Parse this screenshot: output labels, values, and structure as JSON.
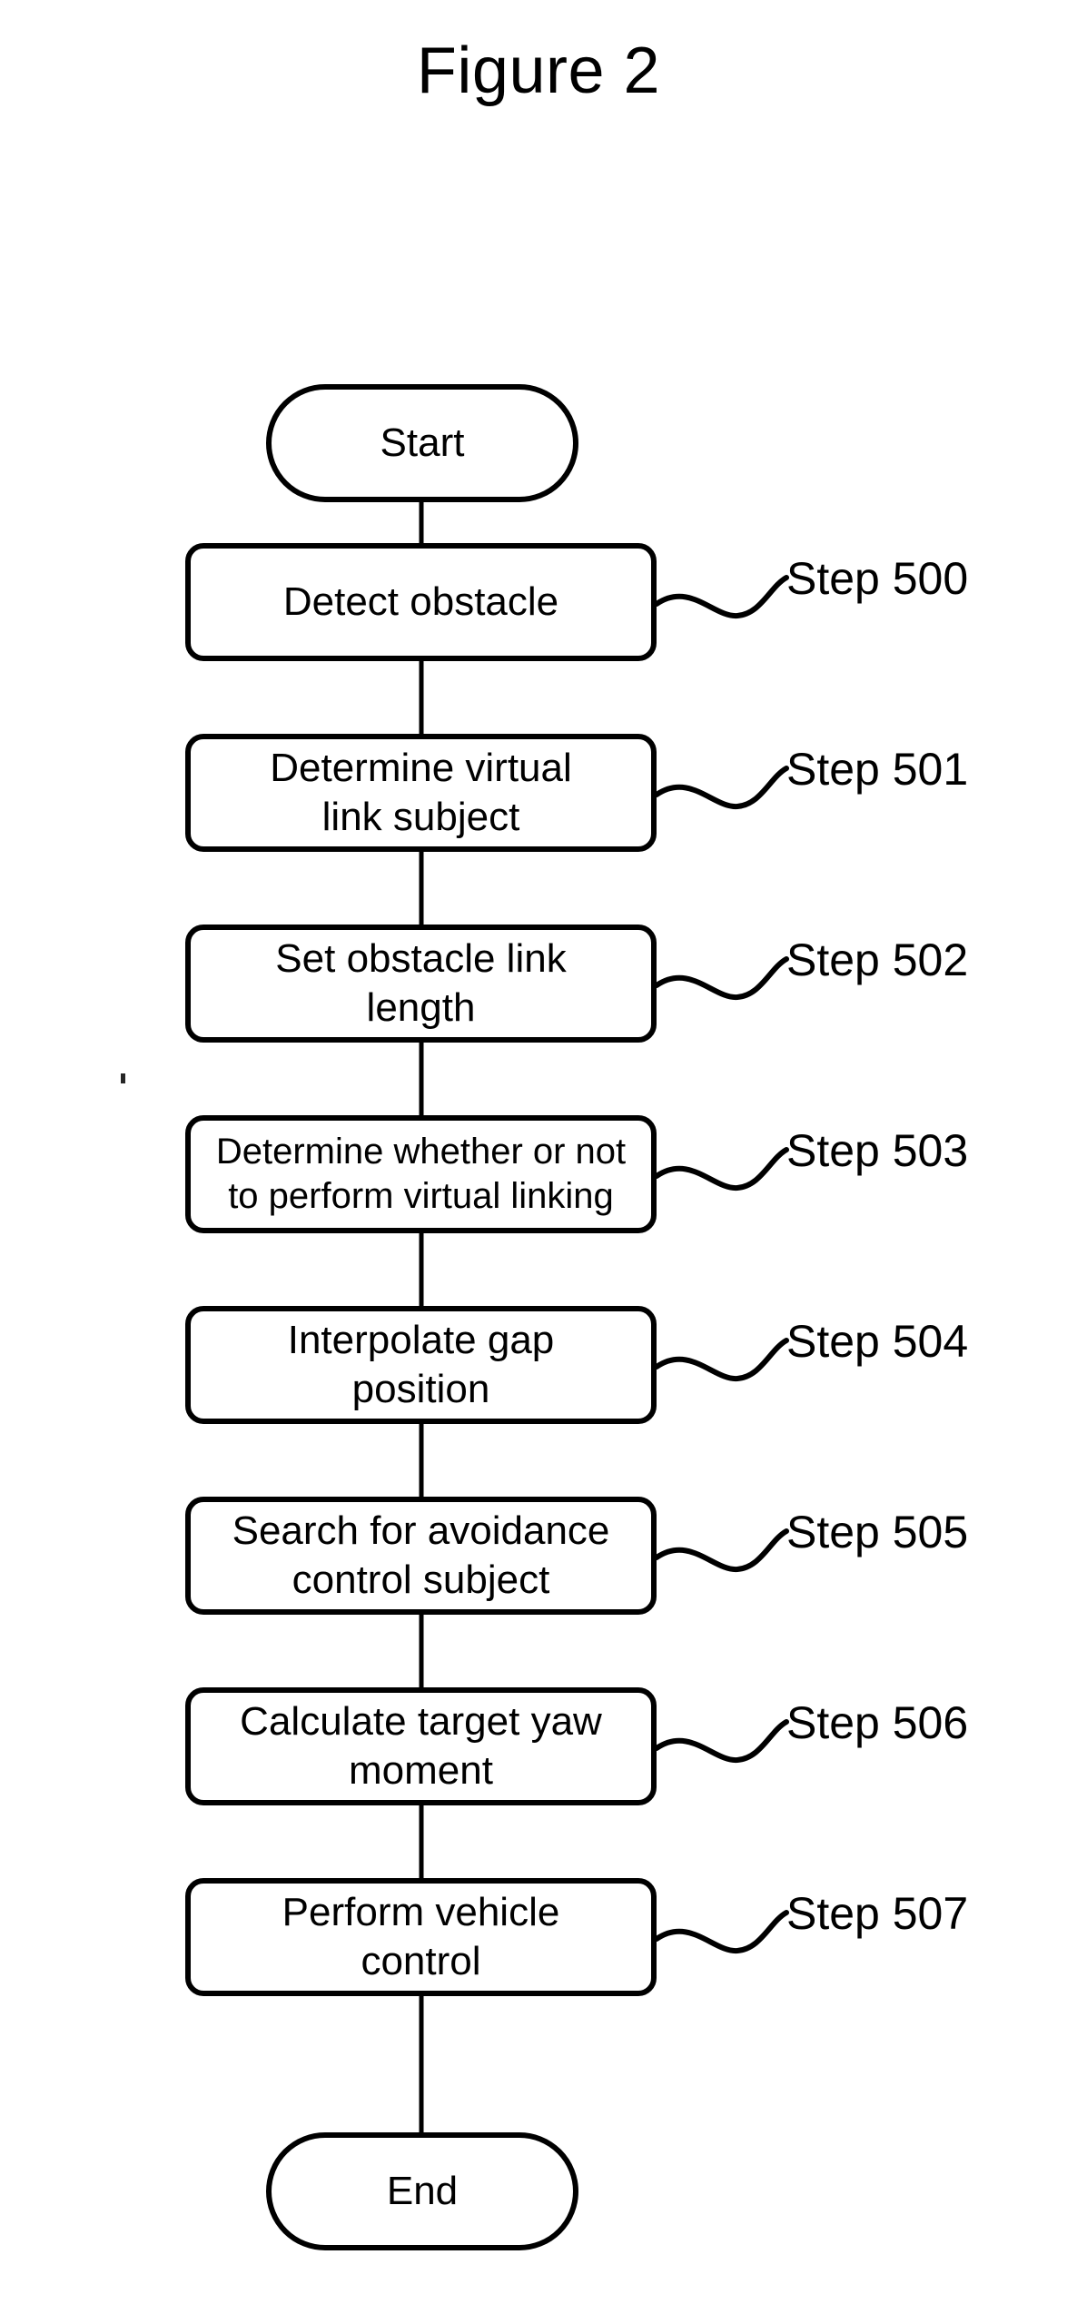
{
  "figure": {
    "title": "Figure 2",
    "type": "flowchart",
    "orientation": "vertical",
    "ink_color": "#000000",
    "background_color": "#ffffff"
  },
  "nodes": [
    {
      "id": "start",
      "shape": "terminator",
      "text": "Start",
      "step_label": null
    },
    {
      "id": "s500",
      "shape": "process",
      "text": "Detect obstacle",
      "step_label": "Step 500"
    },
    {
      "id": "s501",
      "shape": "process",
      "text": "Determine virtual\nlink subject",
      "step_label": "Step 501"
    },
    {
      "id": "s502",
      "shape": "process",
      "text": "Set obstacle link\nlength",
      "step_label": "Step 502"
    },
    {
      "id": "s503",
      "shape": "process",
      "text": "Determine whether or not\nto perform virtual linking",
      "step_label": "Step 503"
    },
    {
      "id": "s504",
      "shape": "process",
      "text": "Interpolate gap\nposition",
      "step_label": "Step 504"
    },
    {
      "id": "s505",
      "shape": "process",
      "text": "Search for avoidance\ncontrol subject",
      "step_label": "Step 505"
    },
    {
      "id": "s506",
      "shape": "process",
      "text": "Calculate target yaw\nmoment",
      "step_label": "Step 506"
    },
    {
      "id": "s507",
      "shape": "process",
      "text": "Perform vehicle\ncontrol",
      "step_label": "Step 507"
    },
    {
      "id": "end",
      "shape": "terminator",
      "text": "End",
      "step_label": null
    }
  ],
  "edges": [
    {
      "from": "start",
      "to": "s500"
    },
    {
      "from": "s500",
      "to": "s501"
    },
    {
      "from": "s501",
      "to": "s502"
    },
    {
      "from": "s502",
      "to": "s503"
    },
    {
      "from": "s503",
      "to": "s504"
    },
    {
      "from": "s504",
      "to": "s505"
    },
    {
      "from": "s505",
      "to": "s506"
    },
    {
      "from": "s506",
      "to": "s507"
    },
    {
      "from": "s507",
      "to": "end"
    }
  ]
}
